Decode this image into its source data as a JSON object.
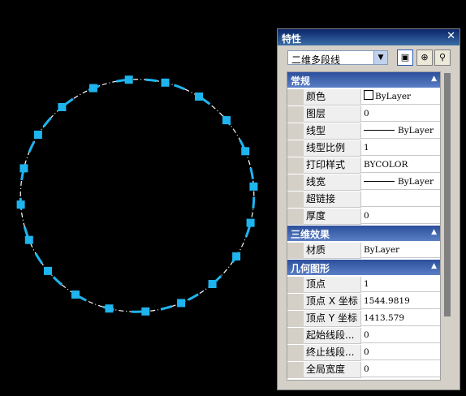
{
  "palette": {
    "title": "特性",
    "close_glyph": "✕",
    "object_type": "二维多段线",
    "buttons": [
      "toggle-pickadd-icon",
      "select-objects-icon",
      "quick-select-icon"
    ]
  },
  "categories": [
    {
      "label": "常规",
      "rows": [
        {
          "name": "颜色",
          "value": "ByLayer",
          "swatch": true
        },
        {
          "name": "图层",
          "value": "0"
        },
        {
          "name": "线型",
          "value": "ByLayer",
          "line": true
        },
        {
          "name": "线型比例",
          "value": "1"
        },
        {
          "name": "打印样式",
          "value": "BYCOLOR"
        },
        {
          "name": "线宽",
          "value": "ByLayer",
          "line": true
        },
        {
          "name": "超链接",
          "value": ""
        },
        {
          "name": "厚度",
          "value": "0"
        }
      ]
    },
    {
      "label": "三维效果",
      "rows": [
        {
          "name": "材质",
          "value": "ByLayer"
        }
      ]
    },
    {
      "label": "几何图形",
      "rows": [
        {
          "name": "顶点",
          "value": "1"
        },
        {
          "name": "顶点 X 坐标",
          "value": "1544.9819"
        },
        {
          "name": "顶点 Y 坐标",
          "value": "1413.579"
        },
        {
          "name": "起始线段...",
          "value": "0"
        },
        {
          "name": "终止线段...",
          "value": "0"
        },
        {
          "name": "全局宽度",
          "value": "0"
        }
      ]
    }
  ],
  "colors": {
    "grip": "#1eb4ee",
    "background": "#000000",
    "header": "#2c4f9c"
  }
}
